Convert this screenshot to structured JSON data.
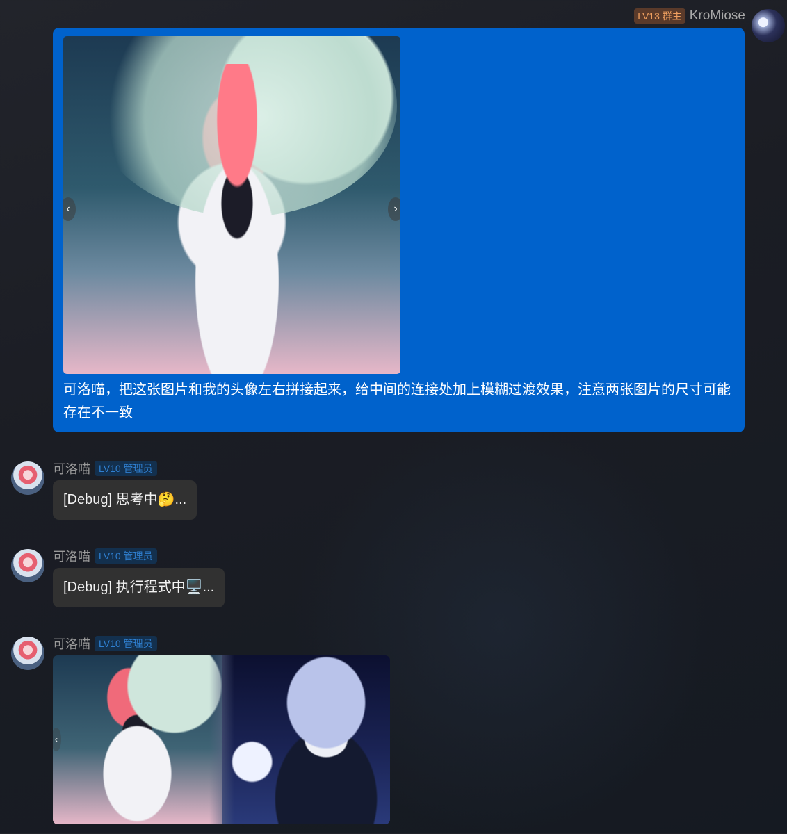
{
  "outgoing": {
    "badge": "LV13 群主",
    "username": "KroMiose",
    "text": "可洛喵，把这张图片和我的头像左右拼接起来，给中间的连接处加上模糊过渡效果，注意两张图片的尺寸可能存在不一致"
  },
  "incoming": [
    {
      "username": "可洛喵",
      "badge": "LV10 管理员",
      "text": "[Debug] 思考中",
      "emoji": "🤔",
      "suffix": "..."
    },
    {
      "username": "可洛喵",
      "badge": "LV10 管理员",
      "text": "[Debug] 执行程式中",
      "emoji": "🖥️",
      "suffix": "..."
    },
    {
      "username": "可洛喵",
      "badge": "LV10 管理员"
    }
  ],
  "carousel": {
    "prev_icon": "‹",
    "next_icon": "›"
  },
  "colors": {
    "outgoing_bubble": "#0062cc",
    "incoming_bubble": "#313131",
    "owner_badge": "#f0a060",
    "admin_badge": "#2f7fd0"
  }
}
